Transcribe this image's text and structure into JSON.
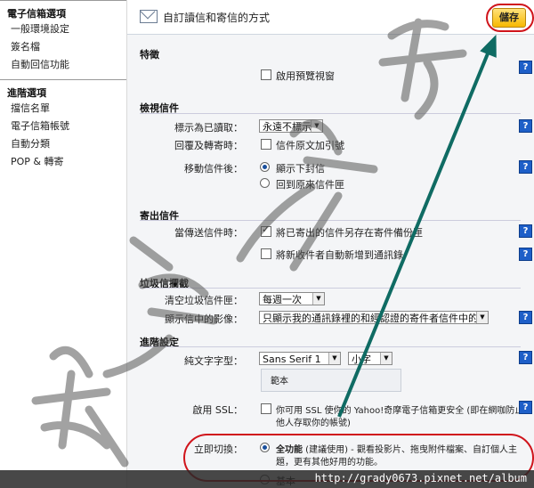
{
  "sidebar": {
    "groups": [
      {
        "heading": "電子信箱選項",
        "items": [
          "一般環境設定",
          "簽名檔",
          "自動回信功能"
        ]
      },
      {
        "heading": "進階選項",
        "items": [
          "擋信名單",
          "電子信箱帳號",
          "自動分類",
          "POP & 轉寄"
        ]
      }
    ]
  },
  "header": {
    "title": "自訂讀信和寄信的方式",
    "save_label": "儲存"
  },
  "sections": {
    "features": {
      "title": "特徵",
      "preview_pane": "啟用預覽視窗"
    },
    "viewing": {
      "title": "檢視信件",
      "mark_read_label": "標示為已讀取：",
      "mark_read_value": "永遠不標示",
      "reply_label": "回覆及轉寄時：",
      "reply_option": "信件原文加引號",
      "after_move_label": "移動信件後：",
      "after_move_opt1": "顯示下封信",
      "after_move_opt2": "回到原來信件匣"
    },
    "sending": {
      "title": "寄出信件",
      "when_sending_label": "當傳送信件時：",
      "save_sent": "將已寄出的信件另存在寄件備份匣",
      "auto_add": "將新收件者自動新增到通訊錄"
    },
    "spam": {
      "title": "垃圾信攔截",
      "empty_spam_label": "清空垃圾信件匣：",
      "empty_spam_value": "每週一次",
      "images_label": "顯示信中的影像：",
      "images_value": "只顯示我的通訊錄裡的和經認證的寄件者信件中的影像"
    },
    "advanced": {
      "title": "進階設定",
      "font_label": "純文字字型：",
      "font_value": "Sans Serif 1",
      "size_value": "小字",
      "sample_text": "範本",
      "ssl_label": "啟用 SSL：",
      "ssl_text_line1": "你可用 SSL 使你的 Yahoo!奇摩電子信箱更安全 (即在網咖防止",
      "ssl_text_line2": "他人存取你的帳號)",
      "switch_label": "立即切換：",
      "full_feature_bold": "全功能",
      "full_feature_rest": " (建議使用) - 觀看投影片、拖曳附件檔案、自訂個人主",
      "full_feature_line2": "題，更有其他好用的功能。",
      "basic_label": "基本"
    }
  },
  "help_glyph": "?",
  "watermark": "http://grady0673.pixnet.net/album",
  "colors": {
    "accent_red": "#d0141b",
    "arrow_teal": "#0f6b63",
    "help_blue": "#1e5fc8"
  }
}
